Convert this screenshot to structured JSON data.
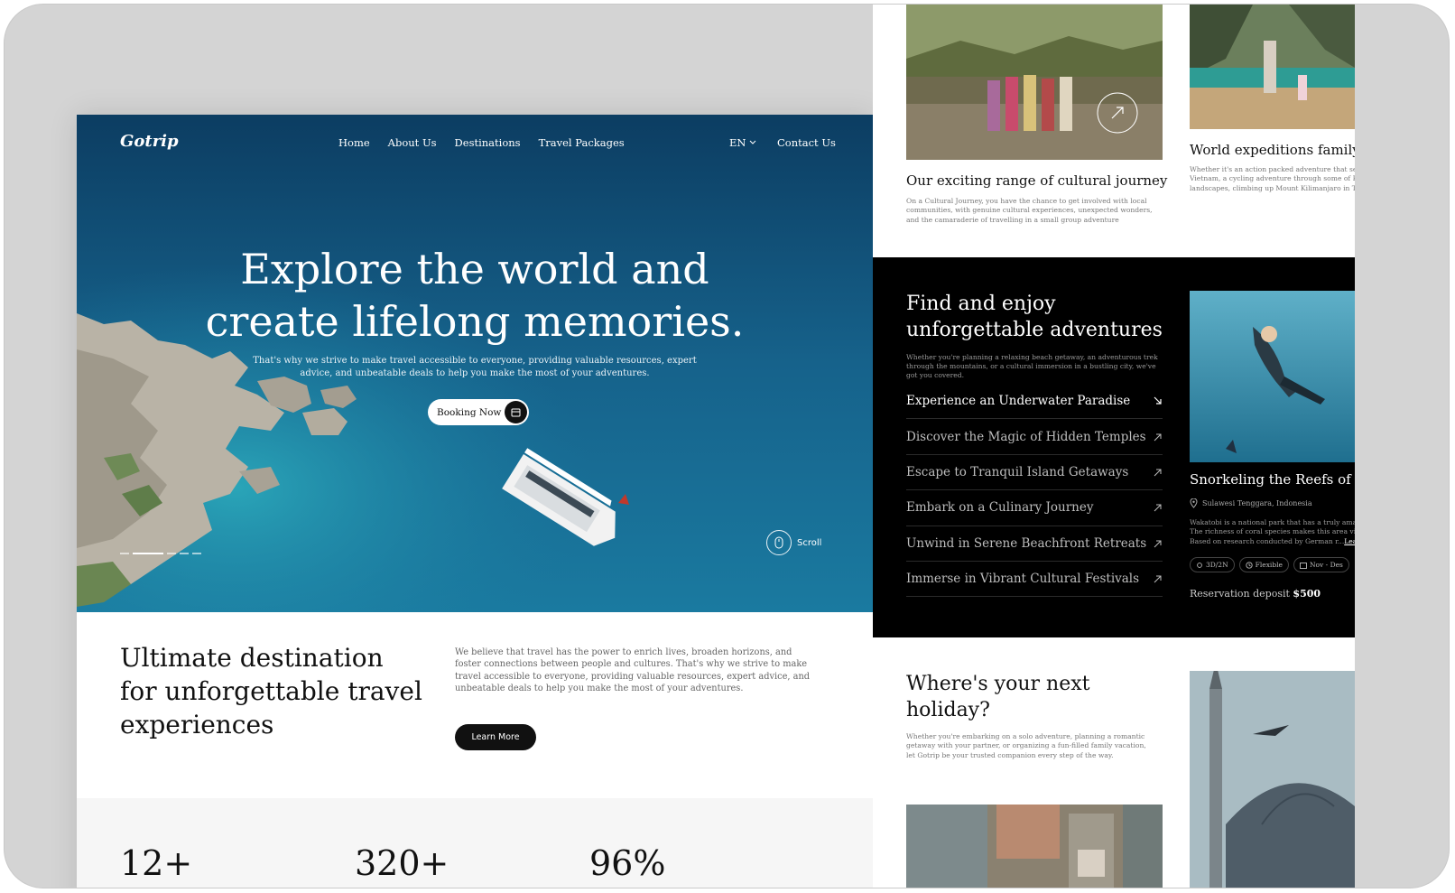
{
  "left_page": {
    "nav": {
      "logo": "Gotrip",
      "links": [
        "Home",
        "About Us",
        "Destinations",
        "Travel Packages"
      ],
      "language": "EN",
      "contact": "Contact Us"
    },
    "hero": {
      "title_line1": "Explore the world and",
      "title_line2": "create lifelong memories.",
      "subtitle": "That's why we strive to make travel accessible to everyone, providing valuable resources, expert advice, and unbeatable deals to help you make the most of your adventures.",
      "booking_label": "Booking Now",
      "scroll_label": "Scroll"
    },
    "intro": {
      "title": "Ultimate destination for unforgettable travel experiences",
      "text": "We believe that travel has the power to enrich lives, broaden horizons, and foster connections between people and cultures. That's why we strive to make travel accessible to everyone, providing valuable resources, expert advice, and unbeatable deals to help you make the most of your adventures.",
      "button": "Learn More"
    },
    "stats": [
      "12+",
      "320+",
      "96%"
    ]
  },
  "right_page": {
    "cultural": {
      "title": "Our exciting range of cultural journey",
      "text": "On a Cultural Journey, you have the chance to get involved with local communities, with genuine cultural experiences, unexpected wonders, and the camaraderie of travelling in a small group adventure"
    },
    "family": {
      "title": "World expeditions family",
      "text": "Whether it's an action packed adventure that sees Vietnam, a cycling adventure through some of E landscapes, climbing up Mount Kilimanjaro in Ta"
    },
    "adventures": {
      "title": "Find and enjoy unforgettable adventures",
      "text": "Whether you're planning a relaxing beach getaway, an adventurous trek through the mountains, or a cultural immersion in a bustling city, we've got you covered.",
      "items": [
        "Experience an Underwater Paradise",
        "Discover the Magic of Hidden Temples",
        "Escape to Tranquil Island Getaways",
        "Embark on a Culinary Journey",
        "Unwind in Serene Beachfront Retreats",
        "Immerse in Vibrant Cultural Festivals"
      ]
    },
    "snorkel": {
      "title": "Snorkeling the Reefs of th",
      "location": "Sulawesi Tenggara, Indonesia",
      "text": "Wakatobi is a national park that has a truly amaz The richness of coral species makes this area vis Based on research conducted by German r...",
      "learn": "Learn",
      "tags": [
        "3D/2N",
        "Flexible",
        "Nov - Des"
      ],
      "deposit_label": "Reservation deposit",
      "deposit_value": "$500"
    },
    "holiday": {
      "title": "Where's your next holiday?",
      "text": "Whether you're embarking on a solo adventure, planning a romantic getaway with your partner, or organizing a fun-filled family vacation, let Gotrip be your trusted companion every step of the way."
    }
  }
}
